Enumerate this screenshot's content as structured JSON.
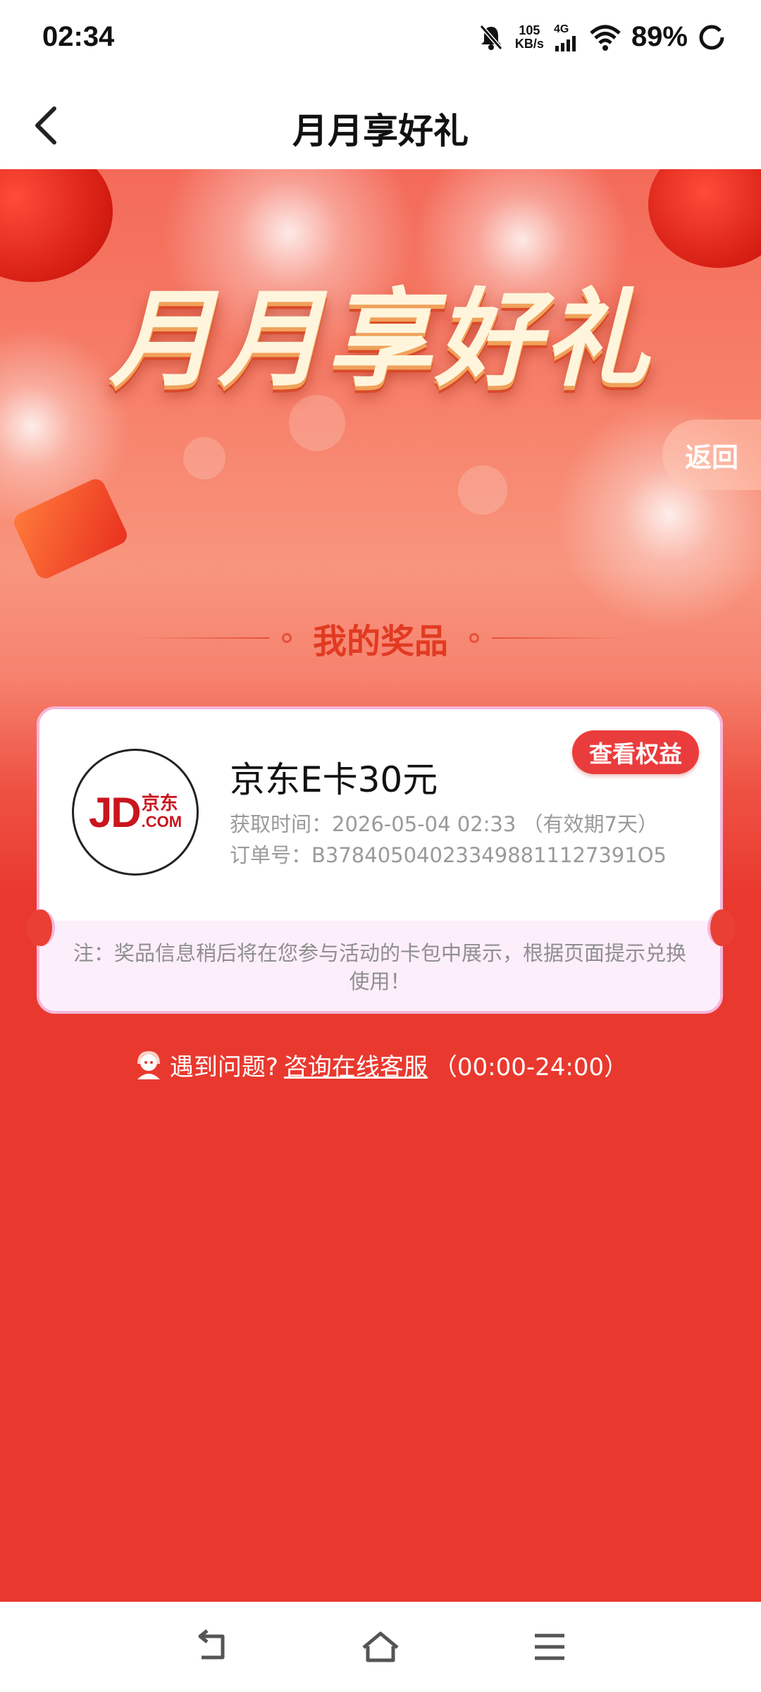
{
  "status_bar": {
    "time": "02:34",
    "speed_value": "105",
    "speed_unit": "KB/s",
    "network": "4G",
    "battery": "89%"
  },
  "header": {
    "title": "月月享好礼"
  },
  "hero": {
    "title": "月月享好礼",
    "return_label": "返回",
    "section_title": "我的奖品"
  },
  "prize": {
    "logo_text_main": "JD",
    "logo_text_cn": "京东",
    "logo_text_com": ".COM",
    "name": "京东E卡30元",
    "time_line": "获取时间：2026-05-04 02:33 （有效期7天）",
    "order_line": "订单号：B378405040233498811127391O5",
    "benefit_button": "查看权益",
    "note": "注：奖品信息稍后将在您参与活动的卡包中展示，根据页面提示兑换使用！"
  },
  "help": {
    "prefix": "遇到问题?",
    "link": "咨询在线客服",
    "hours": "（00:00-24:00）"
  },
  "colors": {
    "page_red": "#e9392f",
    "button_red": "#ea3c3c",
    "card_border": "#f4b7dc",
    "note_bg": "#fdeefb"
  }
}
